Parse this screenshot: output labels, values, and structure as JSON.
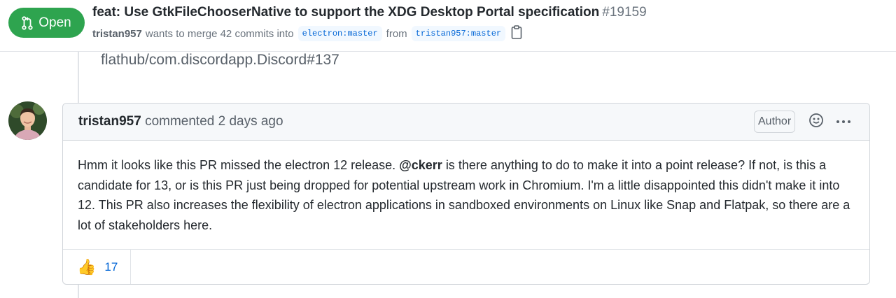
{
  "pr": {
    "state": "Open",
    "title": "feat: Use GtkFileChooserNative to support the XDG Desktop Portal specification",
    "number": "#19159",
    "author": "tristan957",
    "merge_text": "wants to merge 42 commits into",
    "base_branch": "electron:master",
    "from_text": "from",
    "head_branch": "tristan957:master"
  },
  "previous": {
    "text": "flathub/com.discordapp.Discord#137"
  },
  "comment": {
    "author": "tristan957",
    "action": "commented 2 days ago",
    "author_label": "Author",
    "body_part1": "Hmm it looks like this PR missed the electron 12 release.",
    "mention": "@ckerr",
    "body_part2": "is there anything to do to make it into a point release? If not, is this a candidate for 13, or is this PR just being dropped for potential upstream work in Chromium. I'm a little disappointed this didn't make it into 12. This PR also increases the flexibility of electron applications in sandboxed environments on Linux like Snap and Flatpak, so there are a lot of stakeholders here.",
    "reactions": [
      {
        "emoji": "👍",
        "icon": "thumbs-up-icon",
        "count": "17"
      }
    ]
  },
  "colors": {
    "open_green": "#2ea44f",
    "link_blue": "#0366d6",
    "muted": "#586069"
  }
}
